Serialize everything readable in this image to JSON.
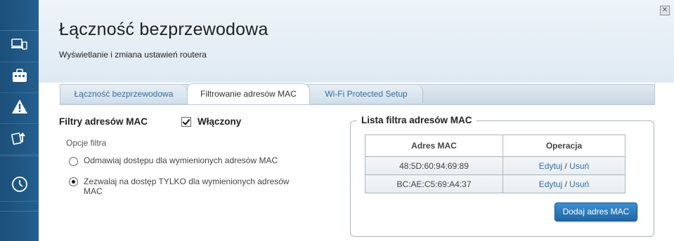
{
  "page": {
    "title": "Łączność bezprzewodowa",
    "subtitle": "Wyświetlanie i zmiana ustawień routera",
    "close_glyph": "✕"
  },
  "sidebar": {
    "icons": [
      "devices-icon",
      "toolbox-icon",
      "warning-icon",
      "update-icon",
      "clock-icon"
    ]
  },
  "tabs": [
    {
      "label": "Łączność bezprzewodowa",
      "active": false
    },
    {
      "label": "Filtrowanie adresów MAC",
      "active": true
    },
    {
      "label": "Wi-Fi Protected Setup",
      "active": false
    }
  ],
  "mac_filters": {
    "title": "Filtry adresów MAC",
    "enabled_label": "Włączony",
    "enabled": true,
    "options_label": "Opcje filtra",
    "options": [
      {
        "label": "Odmawiaj dostępu dla wymienionych adresów MAC",
        "selected": false
      },
      {
        "label": "Zezwalaj na dostęp TYLKO dla wymienionych adresów MAC",
        "selected": true
      }
    ]
  },
  "mac_list": {
    "title": "Lista filtra adresów MAC",
    "columns": [
      "Adres MAC",
      "Operacja"
    ],
    "rows": [
      {
        "mac": "48:5D:60:94:69:89",
        "edit": "Edytuj",
        "sep": " / ",
        "delete": "Usuń"
      },
      {
        "mac": "BC:AE:C5:69:A4:37",
        "edit": "Edytuj",
        "sep": " / ",
        "delete": "Usuń"
      }
    ],
    "add_button": "Dodaj adres MAC"
  },
  "colors": {
    "sidebar": "#1b4f7a",
    "header_bg": "#e6eef5",
    "link": "#2f6fa8",
    "button": "#2a7bbf"
  }
}
